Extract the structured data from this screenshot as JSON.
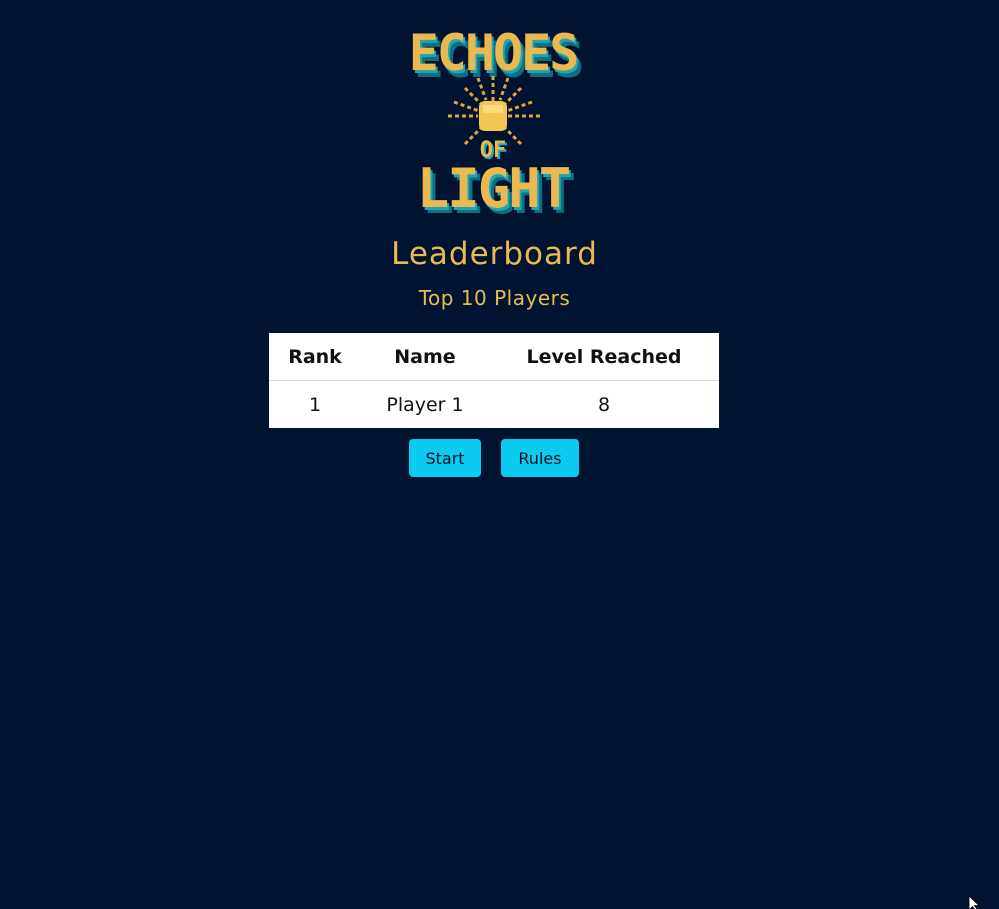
{
  "logo": {
    "line1": "ECHOES",
    "line2": "OF",
    "line3": "LIGHT"
  },
  "page": {
    "title": "Leaderboard",
    "subtitle": "Top 10 Players"
  },
  "table": {
    "headers": [
      "Rank",
      "Name",
      "Level Reached"
    ],
    "rows": [
      {
        "rank": "1",
        "name": "Player 1",
        "level": "8"
      }
    ]
  },
  "buttons": {
    "start": "Start",
    "rules": "Rules"
  },
  "colors": {
    "background": "#001331",
    "accent": "#e8bb50",
    "button": "#0ccbf0",
    "logo_teal": "#1fa6b5"
  }
}
